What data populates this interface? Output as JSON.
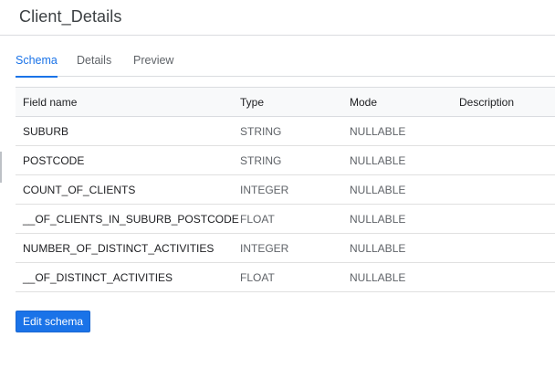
{
  "page": {
    "title": "Client_Details"
  },
  "tabs": [
    {
      "label": "Schema",
      "active": true
    },
    {
      "label": "Details",
      "active": false
    },
    {
      "label": "Preview",
      "active": false
    }
  ],
  "schema": {
    "columns": {
      "name": "Field name",
      "type": "Type",
      "mode": "Mode",
      "description": "Description"
    },
    "rows": [
      {
        "name": "SUBURB",
        "type": "STRING",
        "mode": "NULLABLE",
        "description": ""
      },
      {
        "name": "POSTCODE",
        "type": "STRING",
        "mode": "NULLABLE",
        "description": ""
      },
      {
        "name": "COUNT_OF_CLIENTS",
        "type": "INTEGER",
        "mode": "NULLABLE",
        "description": ""
      },
      {
        "name": "__OF_CLIENTS_IN_SUBURB_POSTCODE",
        "type": "FLOAT",
        "mode": "NULLABLE",
        "description": ""
      },
      {
        "name": "NUMBER_OF_DISTINCT_ACTIVITIES",
        "type": "INTEGER",
        "mode": "NULLABLE",
        "description": ""
      },
      {
        "name": "__OF_DISTINCT_ACTIVITIES",
        "type": "FLOAT",
        "mode": "NULLABLE",
        "description": ""
      }
    ]
  },
  "actions": {
    "edit_schema_label": "Edit schema"
  },
  "colors": {
    "accent": "#1a73e8",
    "header_bg": "#f8f9fa",
    "divider": "#dadce0"
  }
}
